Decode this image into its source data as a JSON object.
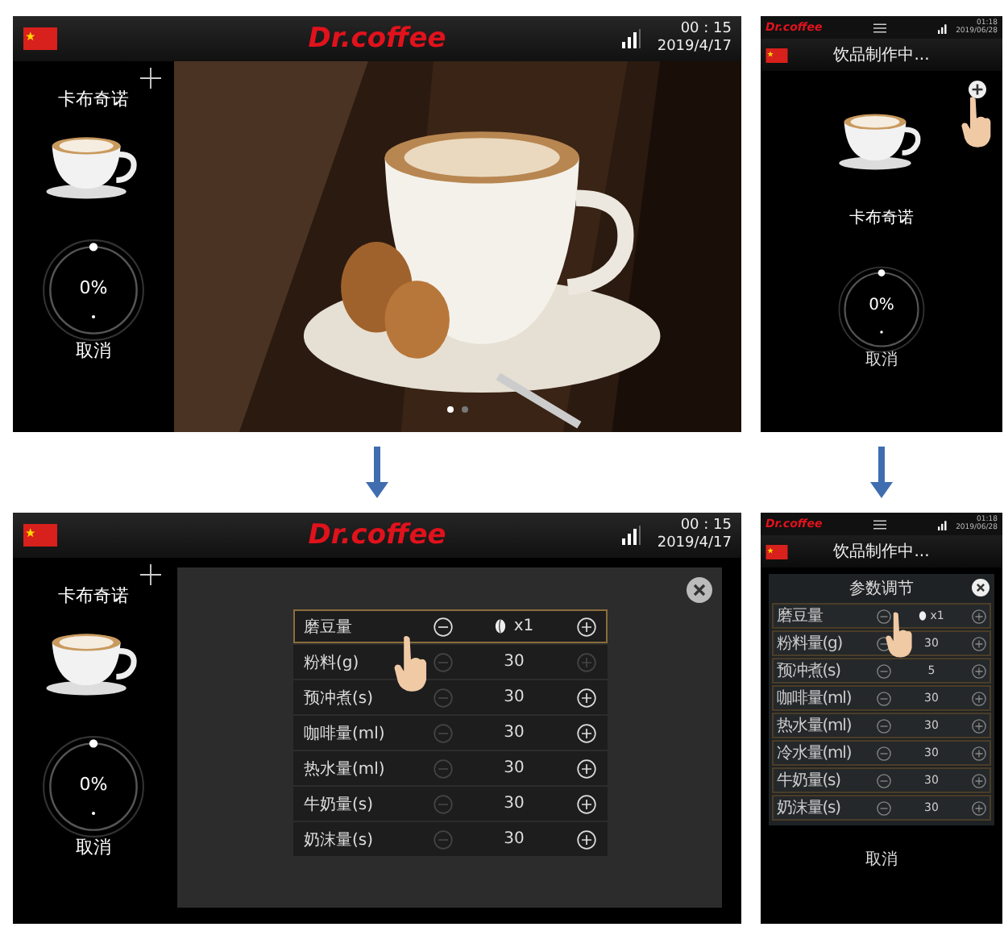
{
  "screens": [
    {
      "kind": "tablet_home",
      "header": {
        "brand": "Dr.coffee",
        "time": "00 : 15",
        "date": "2019/4/17"
      },
      "drink": "卡布奇诺",
      "progress": {
        "level": 0,
        "label": "0%"
      },
      "cancel": "取消",
      "dots": [
        {
          "selected": true
        },
        {
          "selected": false
        }
      ]
    },
    {
      "kind": "phone_home",
      "header": {
        "brand": "Dr.coffee",
        "time": "01:18",
        "date": "2019/06/28"
      },
      "status": "饮品制作中...",
      "drink": "卡布奇诺",
      "progress": {
        "level": 0,
        "label": "0%"
      },
      "cancel": "取消"
    },
    {
      "kind": "tablet_params",
      "header": {
        "brand": "Dr.coffee",
        "time": "00 : 15",
        "date": "2019/4/17"
      },
      "drink": "卡布奇诺",
      "progress": {
        "level": 0,
        "label": "0%"
      },
      "cancel": "取消",
      "rows": [
        {
          "name": "磨豆量",
          "kind": "beans",
          "value": "x1",
          "selected": true,
          "minus_enabled": true,
          "plus_enabled": true
        },
        {
          "name": "粉料(g)",
          "kind": "amount",
          "value": "30",
          "selected": false,
          "minus_enabled": false,
          "plus_enabled": false
        },
        {
          "name": "预冲煮(s)",
          "kind": "amount",
          "value": "30",
          "selected": false,
          "minus_enabled": false,
          "plus_enabled": true
        },
        {
          "name": "咖啡量(ml)",
          "kind": "amount",
          "value": "30",
          "selected": false,
          "minus_enabled": false,
          "plus_enabled": true
        },
        {
          "name": "热水量(ml)",
          "kind": "amount",
          "value": "30",
          "selected": false,
          "minus_enabled": false,
          "plus_enabled": true
        },
        {
          "name": "牛奶量(s)",
          "kind": "amount",
          "value": "30",
          "selected": false,
          "minus_enabled": false,
          "plus_enabled": true
        },
        {
          "name": "奶沫量(s)",
          "kind": "amount",
          "value": "30",
          "selected": false,
          "minus_enabled": false,
          "plus_enabled": true
        }
      ]
    },
    {
      "kind": "phone_params",
      "header": {
        "brand": "Dr.coffee",
        "time": "01:18",
        "date": "2019/06/28"
      },
      "status": "饮品制作中...",
      "title": "参数调节",
      "cancel": "取消",
      "rows": [
        {
          "name": "磨豆量",
          "kind": "beans",
          "value": "x1",
          "selected": false,
          "minus_enabled": true,
          "plus_enabled": true
        },
        {
          "name": "粉料量(g)",
          "kind": "amount",
          "value": "30",
          "selected": false,
          "minus_enabled": true,
          "plus_enabled": true
        },
        {
          "name": "预冲煮(s)",
          "kind": "amount",
          "value": "5",
          "selected": false,
          "minus_enabled": true,
          "plus_enabled": true
        },
        {
          "name": "咖啡量(ml)",
          "kind": "amount",
          "value": "30",
          "selected": false,
          "minus_enabled": true,
          "plus_enabled": true
        },
        {
          "name": "热水量(ml)",
          "kind": "amount",
          "value": "30",
          "selected": false,
          "minus_enabled": true,
          "plus_enabled": true
        },
        {
          "name": "冷水量(ml)",
          "kind": "amount",
          "value": "30",
          "selected": false,
          "minus_enabled": true,
          "plus_enabled": true
        },
        {
          "name": "牛奶量(s)",
          "kind": "amount",
          "value": "30",
          "selected": false,
          "minus_enabled": true,
          "plus_enabled": true
        },
        {
          "name": "奶沫量(s)",
          "kind": "amount",
          "value": "30",
          "selected": false,
          "minus_enabled": true,
          "plus_enabled": true
        }
      ]
    }
  ]
}
